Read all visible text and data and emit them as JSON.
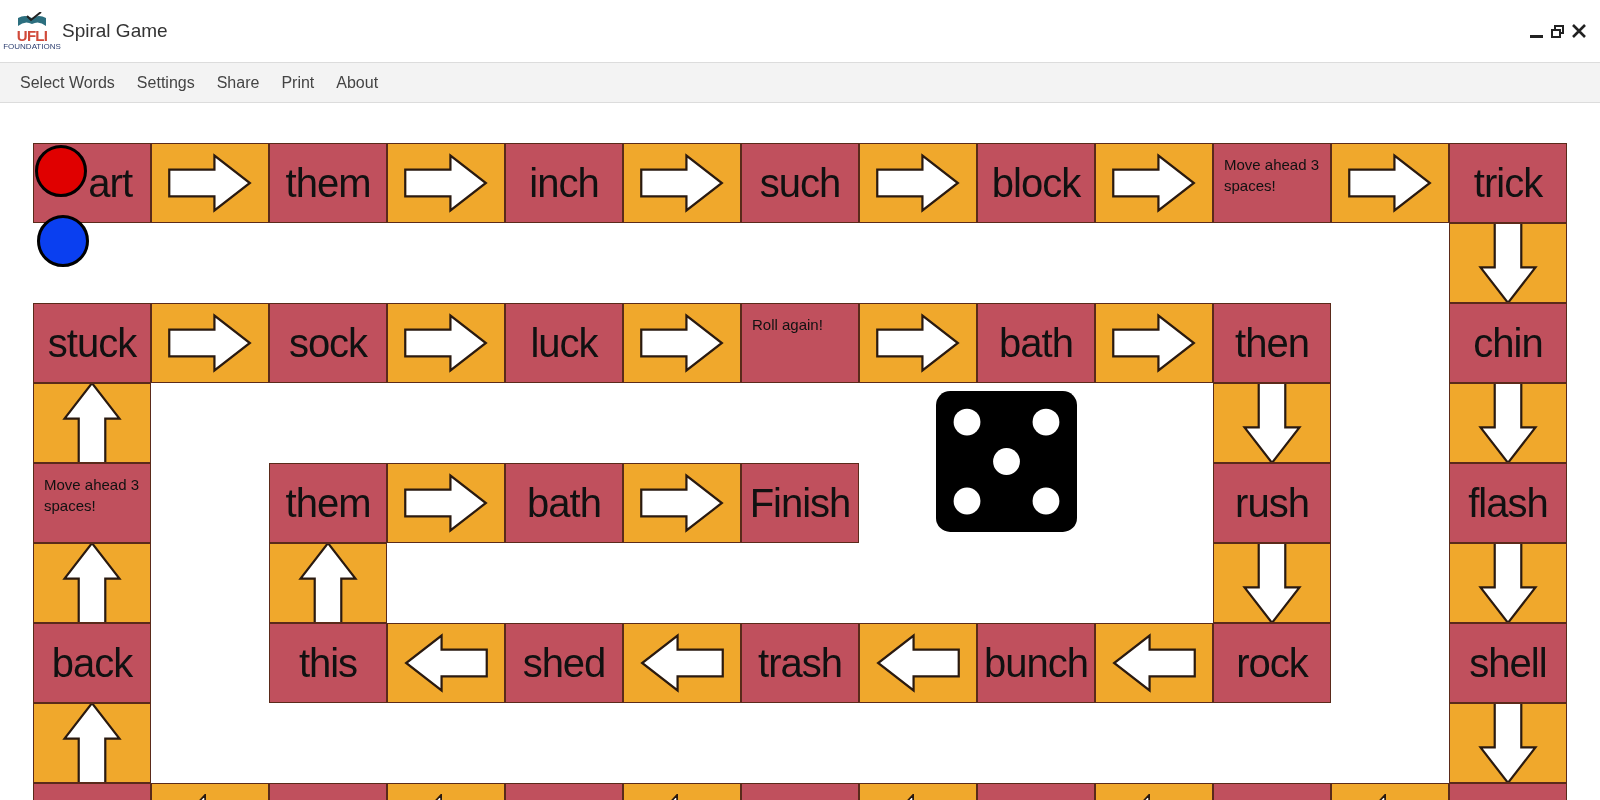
{
  "window": {
    "logo": {
      "letters": "UFLI",
      "caption": "FOUNDATIONS"
    },
    "title": "Spiral Game"
  },
  "menu": [
    "Select Words",
    "Settings",
    "Share",
    "Print",
    "About"
  ],
  "board": {
    "rows": [
      [
        {
          "kind": "covered_word",
          "text": "art"
        },
        {
          "kind": "arrow_right"
        },
        {
          "kind": "word",
          "text": "them"
        },
        {
          "kind": "arrow_right"
        },
        {
          "kind": "word",
          "text": "inch"
        },
        {
          "kind": "arrow_right"
        },
        {
          "kind": "word",
          "text": "such"
        },
        {
          "kind": "arrow_right"
        },
        {
          "kind": "word",
          "text": "block"
        },
        {
          "kind": "arrow_right"
        },
        {
          "kind": "note",
          "text": "Move ahead 3 spaces!"
        },
        {
          "kind": "arrow_right"
        },
        {
          "kind": "word",
          "text": "trick"
        }
      ],
      [
        {
          "kind": "empty"
        },
        {
          "kind": "empty"
        },
        {
          "kind": "empty"
        },
        {
          "kind": "empty"
        },
        {
          "kind": "empty"
        },
        {
          "kind": "empty"
        },
        {
          "kind": "empty"
        },
        {
          "kind": "empty"
        },
        {
          "kind": "empty"
        },
        {
          "kind": "empty"
        },
        {
          "kind": "empty"
        },
        {
          "kind": "empty"
        },
        {
          "kind": "arrow_down"
        }
      ],
      [
        {
          "kind": "word",
          "text": "stuck"
        },
        {
          "kind": "arrow_right"
        },
        {
          "kind": "word",
          "text": "sock"
        },
        {
          "kind": "arrow_right"
        },
        {
          "kind": "word",
          "text": "luck"
        },
        {
          "kind": "arrow_right"
        },
        {
          "kind": "note",
          "text": "Roll again!"
        },
        {
          "kind": "arrow_right"
        },
        {
          "kind": "word",
          "text": "bath"
        },
        {
          "kind": "arrow_right"
        },
        {
          "kind": "word",
          "text": "then"
        },
        {
          "kind": "empty"
        },
        {
          "kind": "word",
          "text": "chin"
        }
      ],
      [
        {
          "kind": "arrow_up"
        },
        {
          "kind": "empty"
        },
        {
          "kind": "empty"
        },
        {
          "kind": "empty"
        },
        {
          "kind": "empty"
        },
        {
          "kind": "empty"
        },
        {
          "kind": "empty"
        },
        {
          "kind": "empty"
        },
        {
          "kind": "empty"
        },
        {
          "kind": "empty"
        },
        {
          "kind": "arrow_down"
        },
        {
          "kind": "empty"
        },
        {
          "kind": "arrow_down"
        }
      ],
      [
        {
          "kind": "note",
          "text": "Move ahead 3 spaces!"
        },
        {
          "kind": "empty"
        },
        {
          "kind": "word",
          "text": "them"
        },
        {
          "kind": "arrow_right"
        },
        {
          "kind": "word",
          "text": "bath"
        },
        {
          "kind": "arrow_right"
        },
        {
          "kind": "word",
          "text": "Finish"
        },
        {
          "kind": "empty"
        },
        {
          "kind": "empty"
        },
        {
          "kind": "empty"
        },
        {
          "kind": "word",
          "text": "rush"
        },
        {
          "kind": "empty"
        },
        {
          "kind": "word",
          "text": "flash"
        }
      ],
      [
        {
          "kind": "arrow_up"
        },
        {
          "kind": "empty"
        },
        {
          "kind": "arrow_up"
        },
        {
          "kind": "empty"
        },
        {
          "kind": "empty"
        },
        {
          "kind": "empty"
        },
        {
          "kind": "empty"
        },
        {
          "kind": "empty"
        },
        {
          "kind": "empty"
        },
        {
          "kind": "empty"
        },
        {
          "kind": "arrow_down"
        },
        {
          "kind": "empty"
        },
        {
          "kind": "arrow_down"
        }
      ],
      [
        {
          "kind": "word",
          "text": "back"
        },
        {
          "kind": "empty"
        },
        {
          "kind": "word",
          "text": "this"
        },
        {
          "kind": "arrow_left"
        },
        {
          "kind": "word",
          "text": "shed"
        },
        {
          "kind": "arrow_left"
        },
        {
          "kind": "word",
          "text": "trash"
        },
        {
          "kind": "arrow_left"
        },
        {
          "kind": "word",
          "text": "bunch"
        },
        {
          "kind": "arrow_left"
        },
        {
          "kind": "word",
          "text": "rock"
        },
        {
          "kind": "empty"
        },
        {
          "kind": "word",
          "text": "shell"
        }
      ],
      [
        {
          "kind": "arrow_up"
        },
        {
          "kind": "empty"
        },
        {
          "kind": "empty"
        },
        {
          "kind": "empty"
        },
        {
          "kind": "empty"
        },
        {
          "kind": "empty"
        },
        {
          "kind": "empty"
        },
        {
          "kind": "empty"
        },
        {
          "kind": "empty"
        },
        {
          "kind": "empty"
        },
        {
          "kind": "empty"
        },
        {
          "kind": "empty"
        },
        {
          "kind": "arrow_down"
        }
      ],
      [
        {
          "kind": "blank"
        },
        {
          "kind": "arrow_left_cut"
        },
        {
          "kind": "blank"
        },
        {
          "kind": "arrow_left_cut"
        },
        {
          "kind": "blank"
        },
        {
          "kind": "arrow_left_cut"
        },
        {
          "kind": "blank"
        },
        {
          "kind": "arrow_left_cut"
        },
        {
          "kind": "blank"
        },
        {
          "kind": "arrow_left_cut"
        },
        {
          "kind": "blank"
        },
        {
          "kind": "arrow_left_cut"
        },
        {
          "kind": "blank"
        }
      ]
    ],
    "tokens": [
      {
        "color": "#e00000"
      },
      {
        "color": "#0a3ff0"
      }
    ],
    "die": {
      "kind": "five"
    }
  }
}
